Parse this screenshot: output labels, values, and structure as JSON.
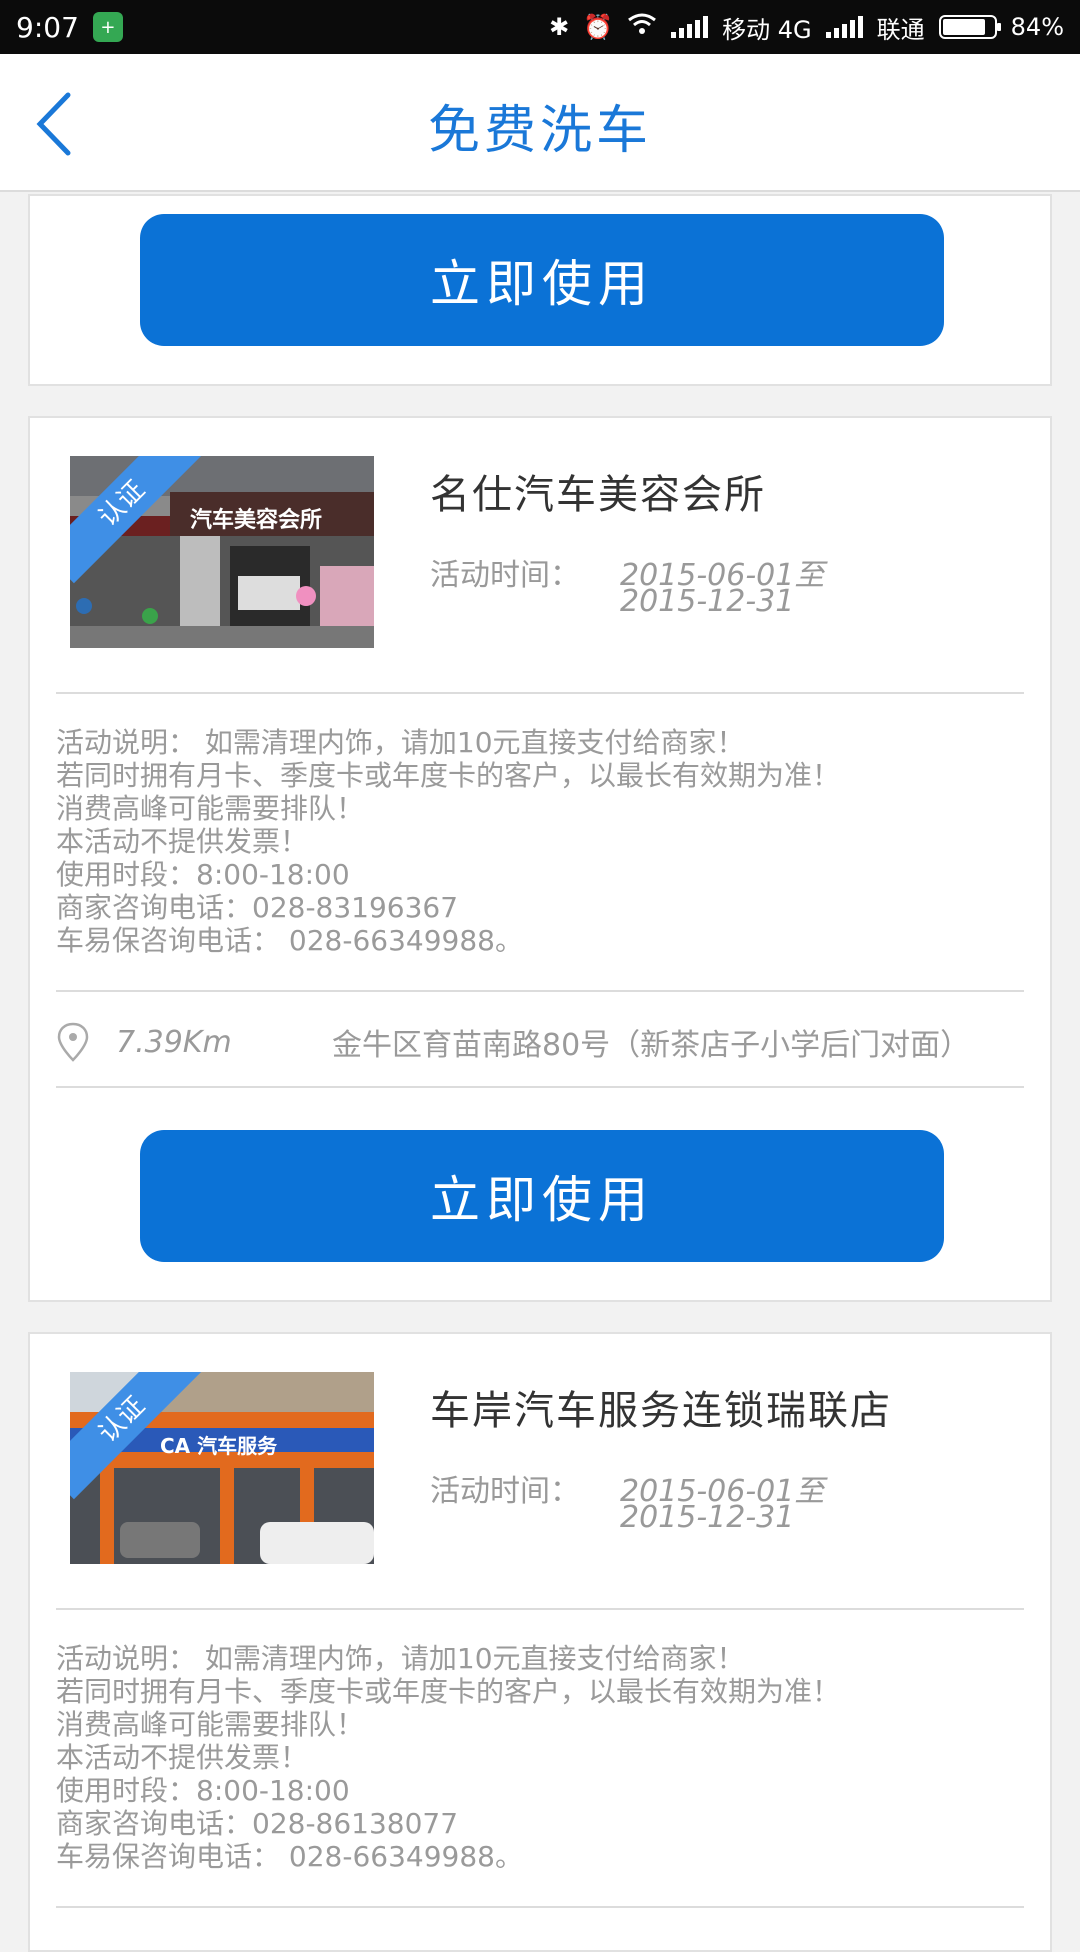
{
  "status_bar": {
    "time": "9:07",
    "carrier1": "移动 4G",
    "carrier2": "联通",
    "battery": "84%"
  },
  "header": {
    "title": "免费洗车"
  },
  "use_button_label": "立即使用",
  "shops": [
    {
      "badge": "认证",
      "name": "名仕汽车美容会所",
      "time_label": "活动时间：",
      "time_start": "2015-06-01至",
      "time_end": "2015-12-31",
      "desc": [
        "活动说明：  如需清理内饰，请加10元直接支付给商家！",
        "若同时拥有月卡、季度卡或年度卡的客户，以最长有效期为准！",
        "消费高峰可能需要排队！",
        "本活动不提供发票！",
        "使用时段：8:00-18:00",
        "商家咨询电话：028-83196367",
        "车易保咨询电话：  028-66349988。"
      ],
      "distance": "7.39Km",
      "address": "金牛区育苗南路80号（新茶店子小学后门对面）",
      "photo_sign": "汽车美容会所"
    },
    {
      "badge": "认证",
      "name": "车岸汽车服务连锁瑞联店",
      "time_label": "活动时间：",
      "time_start": "2015-06-01至",
      "time_end": "2015-12-31",
      "desc": [
        "活动说明：   如需清理内饰，请加10元直接支付给商家！",
        "若同时拥有月卡、季度卡或年度卡的客户，以最长有效期为准！",
        "消费高峰可能需要排队！",
        "本活动不提供发票！",
        "使用时段：8:00-18:00",
        "商家咨询电话：028-86138077",
        "车易保咨询电话：  028-66349988。"
      ],
      "photo_sign": "CA 汽车服务"
    }
  ]
}
